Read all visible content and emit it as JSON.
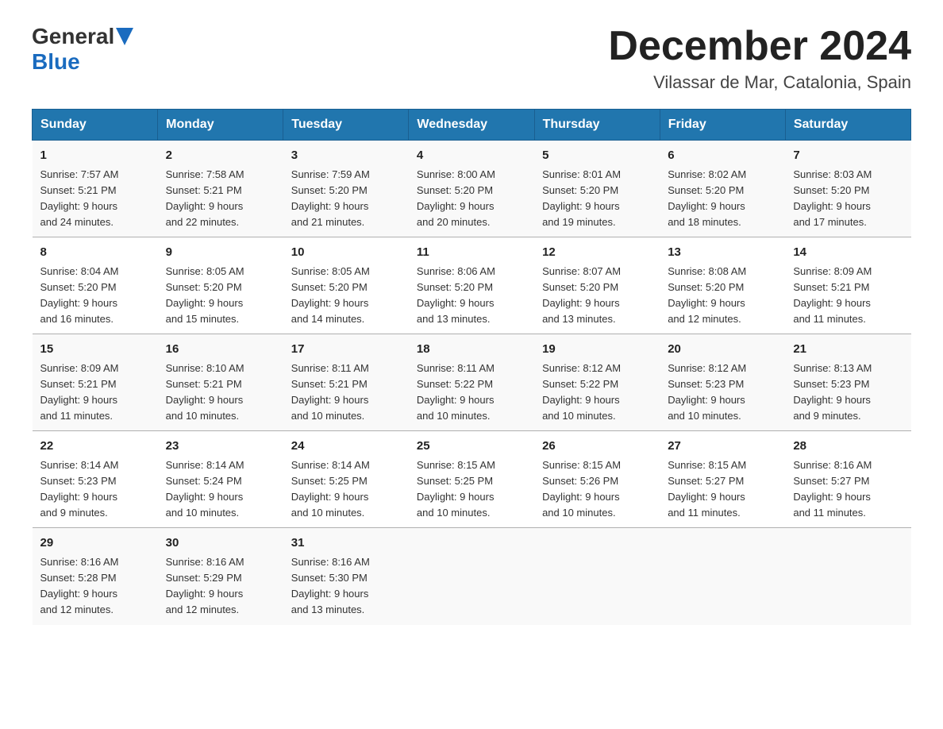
{
  "header": {
    "logo_text_general": "General",
    "logo_text_blue": "Blue",
    "title": "December 2024",
    "subtitle": "Vilassar de Mar, Catalonia, Spain"
  },
  "columns": [
    "Sunday",
    "Monday",
    "Tuesday",
    "Wednesday",
    "Thursday",
    "Friday",
    "Saturday"
  ],
  "weeks": [
    [
      {
        "day": "1",
        "info": "Sunrise: 7:57 AM\nSunset: 5:21 PM\nDaylight: 9 hours\nand 24 minutes."
      },
      {
        "day": "2",
        "info": "Sunrise: 7:58 AM\nSunset: 5:21 PM\nDaylight: 9 hours\nand 22 minutes."
      },
      {
        "day": "3",
        "info": "Sunrise: 7:59 AM\nSunset: 5:20 PM\nDaylight: 9 hours\nand 21 minutes."
      },
      {
        "day": "4",
        "info": "Sunrise: 8:00 AM\nSunset: 5:20 PM\nDaylight: 9 hours\nand 20 minutes."
      },
      {
        "day": "5",
        "info": "Sunrise: 8:01 AM\nSunset: 5:20 PM\nDaylight: 9 hours\nand 19 minutes."
      },
      {
        "day": "6",
        "info": "Sunrise: 8:02 AM\nSunset: 5:20 PM\nDaylight: 9 hours\nand 18 minutes."
      },
      {
        "day": "7",
        "info": "Sunrise: 8:03 AM\nSunset: 5:20 PM\nDaylight: 9 hours\nand 17 minutes."
      }
    ],
    [
      {
        "day": "8",
        "info": "Sunrise: 8:04 AM\nSunset: 5:20 PM\nDaylight: 9 hours\nand 16 minutes."
      },
      {
        "day": "9",
        "info": "Sunrise: 8:05 AM\nSunset: 5:20 PM\nDaylight: 9 hours\nand 15 minutes."
      },
      {
        "day": "10",
        "info": "Sunrise: 8:05 AM\nSunset: 5:20 PM\nDaylight: 9 hours\nand 14 minutes."
      },
      {
        "day": "11",
        "info": "Sunrise: 8:06 AM\nSunset: 5:20 PM\nDaylight: 9 hours\nand 13 minutes."
      },
      {
        "day": "12",
        "info": "Sunrise: 8:07 AM\nSunset: 5:20 PM\nDaylight: 9 hours\nand 13 minutes."
      },
      {
        "day": "13",
        "info": "Sunrise: 8:08 AM\nSunset: 5:20 PM\nDaylight: 9 hours\nand 12 minutes."
      },
      {
        "day": "14",
        "info": "Sunrise: 8:09 AM\nSunset: 5:21 PM\nDaylight: 9 hours\nand 11 minutes."
      }
    ],
    [
      {
        "day": "15",
        "info": "Sunrise: 8:09 AM\nSunset: 5:21 PM\nDaylight: 9 hours\nand 11 minutes."
      },
      {
        "day": "16",
        "info": "Sunrise: 8:10 AM\nSunset: 5:21 PM\nDaylight: 9 hours\nand 10 minutes."
      },
      {
        "day": "17",
        "info": "Sunrise: 8:11 AM\nSunset: 5:21 PM\nDaylight: 9 hours\nand 10 minutes."
      },
      {
        "day": "18",
        "info": "Sunrise: 8:11 AM\nSunset: 5:22 PM\nDaylight: 9 hours\nand 10 minutes."
      },
      {
        "day": "19",
        "info": "Sunrise: 8:12 AM\nSunset: 5:22 PM\nDaylight: 9 hours\nand 10 minutes."
      },
      {
        "day": "20",
        "info": "Sunrise: 8:12 AM\nSunset: 5:23 PM\nDaylight: 9 hours\nand 10 minutes."
      },
      {
        "day": "21",
        "info": "Sunrise: 8:13 AM\nSunset: 5:23 PM\nDaylight: 9 hours\nand 9 minutes."
      }
    ],
    [
      {
        "day": "22",
        "info": "Sunrise: 8:14 AM\nSunset: 5:23 PM\nDaylight: 9 hours\nand 9 minutes."
      },
      {
        "day": "23",
        "info": "Sunrise: 8:14 AM\nSunset: 5:24 PM\nDaylight: 9 hours\nand 10 minutes."
      },
      {
        "day": "24",
        "info": "Sunrise: 8:14 AM\nSunset: 5:25 PM\nDaylight: 9 hours\nand 10 minutes."
      },
      {
        "day": "25",
        "info": "Sunrise: 8:15 AM\nSunset: 5:25 PM\nDaylight: 9 hours\nand 10 minutes."
      },
      {
        "day": "26",
        "info": "Sunrise: 8:15 AM\nSunset: 5:26 PM\nDaylight: 9 hours\nand 10 minutes."
      },
      {
        "day": "27",
        "info": "Sunrise: 8:15 AM\nSunset: 5:27 PM\nDaylight: 9 hours\nand 11 minutes."
      },
      {
        "day": "28",
        "info": "Sunrise: 8:16 AM\nSunset: 5:27 PM\nDaylight: 9 hours\nand 11 minutes."
      }
    ],
    [
      {
        "day": "29",
        "info": "Sunrise: 8:16 AM\nSunset: 5:28 PM\nDaylight: 9 hours\nand 12 minutes."
      },
      {
        "day": "30",
        "info": "Sunrise: 8:16 AM\nSunset: 5:29 PM\nDaylight: 9 hours\nand 12 minutes."
      },
      {
        "day": "31",
        "info": "Sunrise: 8:16 AM\nSunset: 5:30 PM\nDaylight: 9 hours\nand 13 minutes."
      },
      {
        "day": "",
        "info": ""
      },
      {
        "day": "",
        "info": ""
      },
      {
        "day": "",
        "info": ""
      },
      {
        "day": "",
        "info": ""
      }
    ]
  ]
}
